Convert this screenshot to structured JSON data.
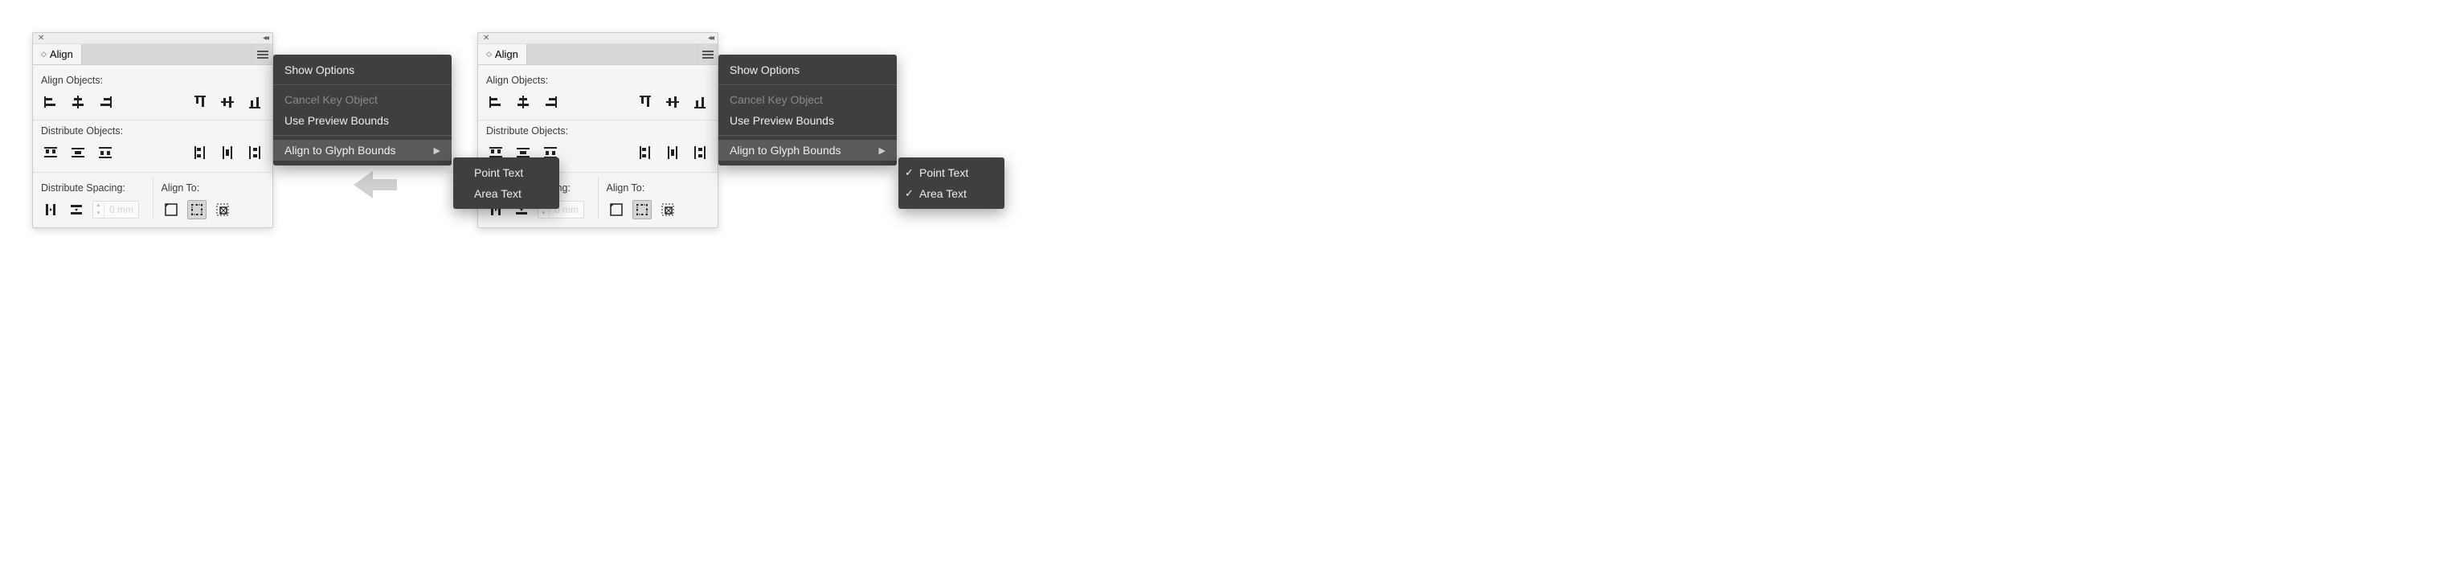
{
  "panel": {
    "title": "Align",
    "sections": {
      "align_objects": "Align Objects:",
      "distribute_objects": "Distribute Objects:",
      "distribute_spacing": "Distribute Spacing:",
      "align_to": "Align To:"
    },
    "spacing_value": "0 mm"
  },
  "flyout": {
    "show_options": "Show Options",
    "cancel_key_object": "Cancel Key Object",
    "use_preview_bounds": "Use Preview Bounds",
    "align_to_glyph_bounds": "Align to Glyph Bounds"
  },
  "submenu": {
    "point_text": "Point Text",
    "area_text": "Area Text"
  },
  "left_submenu_checks": {
    "point": false,
    "area": false
  },
  "right_submenu_checks": {
    "point": true,
    "area": true
  }
}
